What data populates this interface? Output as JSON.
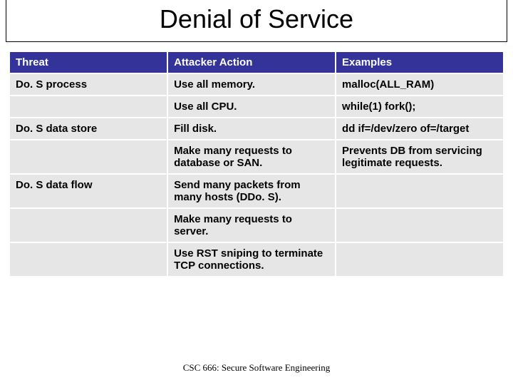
{
  "title": "Denial of Service",
  "headers": {
    "c0": "Threat",
    "c1": "Attacker Action",
    "c2": "Examples"
  },
  "rows": [
    {
      "c0": "Do. S process",
      "c1": "Use all memory.",
      "c2": "malloc(ALL_RAM)"
    },
    {
      "c0": "",
      "c1": "Use all CPU.",
      "c2": "while(1) fork();"
    },
    {
      "c0": "Do. S data store",
      "c1": "Fill disk.",
      "c2": "dd if=/dev/zero of=/target"
    },
    {
      "c0": "",
      "c1": "Make many requests to database or SAN.",
      "c2": "Prevents DB from servicing legitimate requests."
    },
    {
      "c0": "Do. S data flow",
      "c1": "Send many packets from many hosts (DDo. S).",
      "c2": ""
    },
    {
      "c0": "",
      "c1": "Make many requests to server.",
      "c2": ""
    },
    {
      "c0": "",
      "c1": "Use RST sniping to terminate TCP connections.",
      "c2": ""
    }
  ],
  "footer": "CSC 666: Secure Software Engineering"
}
